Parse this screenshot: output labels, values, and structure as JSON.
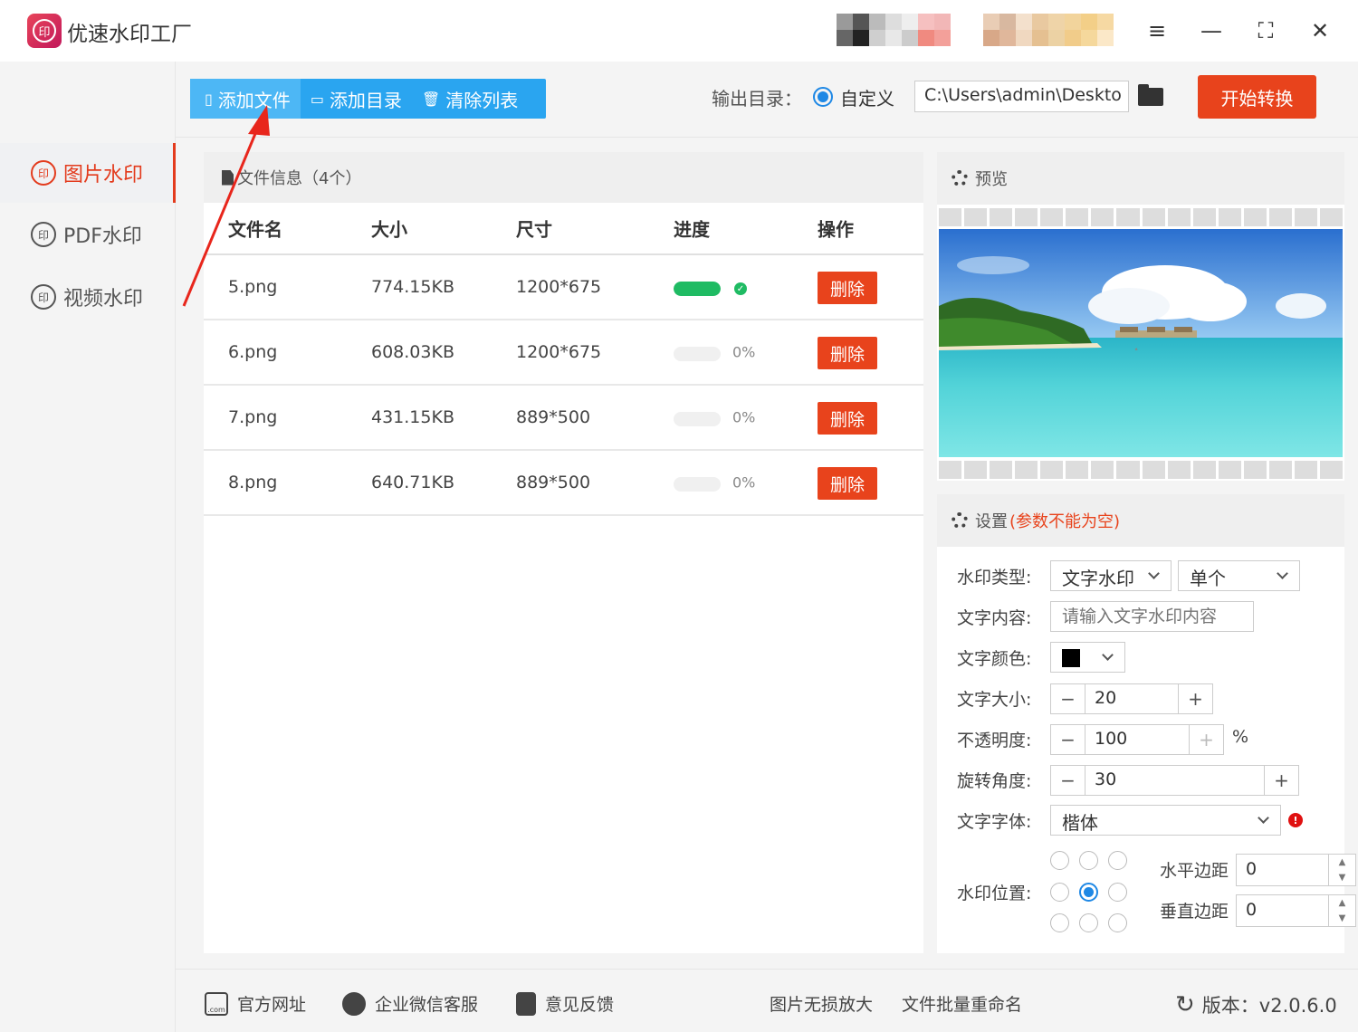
{
  "app": {
    "title": "优速水印工厂",
    "logo_glyph": "印"
  },
  "window_controls": [
    {
      "name": "menu-icon",
      "glyph": "≡"
    },
    {
      "name": "minimize-icon",
      "glyph": "—"
    },
    {
      "name": "maximize-icon",
      "glyph": "⛶"
    },
    {
      "name": "close-icon",
      "glyph": "✕"
    }
  ],
  "sidebar": {
    "items": [
      {
        "label": "图片水印",
        "active": true
      },
      {
        "label": "PDF水印",
        "active": false
      },
      {
        "label": "视频水印",
        "active": false
      }
    ]
  },
  "toolbar": {
    "add_file": "添加文件",
    "add_dir": "添加目录",
    "clear_list": "清除列表",
    "output_label": "输出目录：",
    "custom_label": "自定义",
    "output_path": "C:\\Users\\admin\\Deskto",
    "start_label": "开始转换"
  },
  "files": {
    "header": "文件信息（4个）",
    "columns": [
      "文件名",
      "大小",
      "尺寸",
      "进度",
      "操作"
    ],
    "rows": [
      {
        "name": "5.png",
        "size": "774.15KB",
        "dims": "1200*675",
        "progress": 1.0,
        "progress_text": "",
        "action": "删除"
      },
      {
        "name": "6.png",
        "size": "608.03KB",
        "dims": "1200*675",
        "progress": 0.0,
        "progress_text": "0%",
        "action": "删除"
      },
      {
        "name": "7.png",
        "size": "431.15KB",
        "dims": "889*500",
        "progress": 0.0,
        "progress_text": "0%",
        "action": "删除"
      },
      {
        "name": "8.png",
        "size": "640.71KB",
        "dims": "889*500",
        "progress": 0.0,
        "progress_text": "0%",
        "action": "删除"
      }
    ]
  },
  "preview": {
    "title": "预览"
  },
  "settings": {
    "title": "设置",
    "warning": "(参数不能为空)",
    "type_label": "水印类型:",
    "type_value": "文字水印",
    "mode_value": "单个",
    "content_label": "文字内容:",
    "content_placeholder": "请输入文字水印内容",
    "color_label": "文字颜色:",
    "color_value": "#000000",
    "size_label": "文字大小:",
    "size_value": "20",
    "opacity_label": "不透明度:",
    "opacity_value": "100",
    "opacity_unit": "%",
    "rotate_label": "旋转角度:",
    "rotate_value": "30",
    "font_label": "文字字体:",
    "font_value": "楷体",
    "position_label": "水印位置:",
    "position_selected": 4,
    "h_margin_label": "水平边距",
    "h_margin_value": "0",
    "v_margin_label": "垂直边距",
    "v_margin_value": "0"
  },
  "footer": {
    "website": "官方网址",
    "wechat": "企业微信客服",
    "feedback": "意见反馈",
    "upscale": "图片无损放大",
    "rename": "文件批量重命名",
    "version": "版本：v2.0.6.0"
  },
  "colors": {
    "accent": "#e8431c",
    "blue": "#2aa5f0",
    "green": "#1fbb63"
  }
}
